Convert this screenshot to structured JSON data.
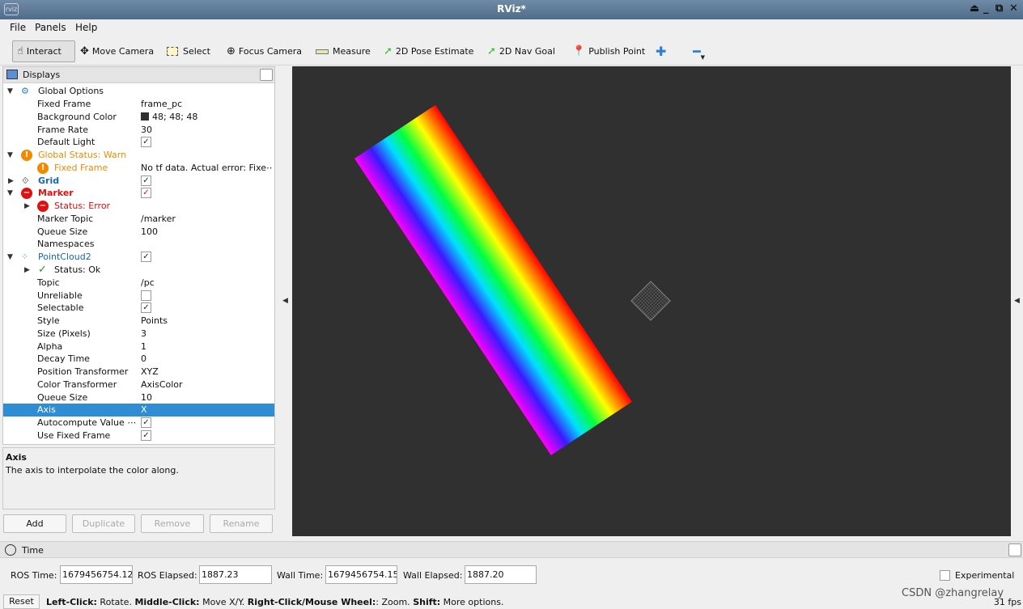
{
  "window": {
    "title": "RViz*",
    "icon_label": "rviz"
  },
  "menu": [
    "File",
    "Panels",
    "Help"
  ],
  "toolbar": [
    {
      "label": "Interact",
      "icon": "hand-pointer-icon",
      "active": true
    },
    {
      "label": "Move Camera",
      "icon": "move-camera-icon"
    },
    {
      "label": "Select",
      "icon": "select-box-icon"
    },
    {
      "label": "Focus Camera",
      "icon": "focus-camera-icon"
    },
    {
      "label": "Measure",
      "icon": "ruler-icon"
    },
    {
      "label": "2D Pose Estimate",
      "icon": "green-arrow-icon"
    },
    {
      "label": "2D Nav Goal",
      "icon": "green-arrow-icon"
    },
    {
      "label": "Publish Point",
      "icon": "map-pin-icon"
    }
  ],
  "displays": {
    "title": "Displays",
    "rows": [
      {
        "key": "Global Options",
        "value": ""
      },
      {
        "key": "Fixed Frame",
        "value": "frame_pc"
      },
      {
        "key": "Background Color",
        "value": "48; 48; 48"
      },
      {
        "key": "Frame Rate",
        "value": "30"
      },
      {
        "key": "Default Light",
        "value": "✓"
      },
      {
        "key": "Global Status: Warn",
        "value": ""
      },
      {
        "key": "Fixed Frame",
        "value": "No tf data.  Actual error: Fixe⋯"
      },
      {
        "key": "Grid",
        "value": "✓"
      },
      {
        "key": "Marker",
        "value": "✓"
      },
      {
        "key": "Status: Error",
        "value": ""
      },
      {
        "key": "Marker Topic",
        "value": "/marker"
      },
      {
        "key": "Queue Size",
        "value": "100"
      },
      {
        "key": "Namespaces",
        "value": ""
      },
      {
        "key": "PointCloud2",
        "value": "✓"
      },
      {
        "key": "Status: Ok",
        "value": ""
      },
      {
        "key": "Topic",
        "value": "/pc"
      },
      {
        "key": "Unreliable",
        "value": ""
      },
      {
        "key": "Selectable",
        "value": "✓"
      },
      {
        "key": "Style",
        "value": "Points"
      },
      {
        "key": "Size (Pixels)",
        "value": "3"
      },
      {
        "key": "Alpha",
        "value": "1"
      },
      {
        "key": "Decay Time",
        "value": "0"
      },
      {
        "key": "Position Transformer",
        "value": "XYZ"
      },
      {
        "key": "Color Transformer",
        "value": "AxisColor"
      },
      {
        "key": "Queue Size",
        "value": "10"
      },
      {
        "key": "Axis",
        "value": "X"
      },
      {
        "key": "Autocompute Value ⋯",
        "value": "✓"
      },
      {
        "key": "Use Fixed Frame",
        "value": "✓"
      }
    ]
  },
  "description": {
    "title": "Axis",
    "text": "The axis to interpolate the color along."
  },
  "buttons": {
    "add": "Add",
    "duplicate": "Duplicate",
    "remove": "Remove",
    "rename": "Rename"
  },
  "time": {
    "title": "Time",
    "ros_time_label": "ROS Time:",
    "ros_time": "1679456754.12",
    "ros_elapsed_label": "ROS Elapsed:",
    "ros_elapsed": "1887.23",
    "wall_time_label": "Wall Time:",
    "wall_time": "1679456754.15",
    "wall_elapsed_label": "Wall Elapsed:",
    "wall_elapsed": "1887.20",
    "experimental_label": "Experimental"
  },
  "status": {
    "reset": "Reset",
    "left_click_b": "Left-Click:",
    "left_click": " Rotate. ",
    "middle_click_b": "Middle-Click:",
    "middle_click": " Move X/Y. ",
    "right_click_b": "Right-Click/Mouse Wheel:",
    "right_click": ": Zoom. ",
    "shift_b": "Shift:",
    "shift": " More options.",
    "fps": "31 fps"
  },
  "watermark": "CSDN @zhangrelay",
  "colors": {
    "viewport_bg": "#303030",
    "selection": "#2f8ed3",
    "warn": "#f08a00",
    "error": "#e01010",
    "link_blue": "#1565c0"
  }
}
